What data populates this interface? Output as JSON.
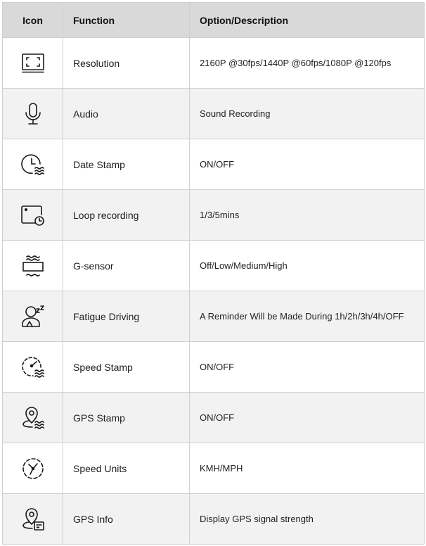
{
  "header": {
    "icon": "Icon",
    "function": "Function",
    "description": "Option/Description"
  },
  "rows": [
    {
      "icon": "resolution-frame-icon",
      "function": "Resolution",
      "description": "2160P @30fps/1440P @60fps/1080P @120fps"
    },
    {
      "icon": "microphone-icon",
      "function": "Audio",
      "description": "Sound Recording"
    },
    {
      "icon": "clock-stamp-icon",
      "function": "Date Stamp",
      "description": "ON/OFF"
    },
    {
      "icon": "loop-recording-icon",
      "function": "Loop recording",
      "description": "1/3/5mins"
    },
    {
      "icon": "g-sensor-icon",
      "function": "G-sensor",
      "description": "Off/Low/Medium/High"
    },
    {
      "icon": "fatigue-driver-icon",
      "function": "Fatigue Driving",
      "description": "A Reminder Will be Made During 1h/2h/3h/4h/OFF"
    },
    {
      "icon": "speedometer-stamp-icon",
      "function": "Speed Stamp",
      "description": "ON/OFF"
    },
    {
      "icon": "location-pin-stamp-icon",
      "function": "GPS Stamp",
      "description": "ON/OFF"
    },
    {
      "icon": "speedometer-icon",
      "function": "Speed Units",
      "description": "KMH/MPH"
    },
    {
      "icon": "location-pin-info-icon",
      "function": "GPS Info",
      "description": "Display GPS signal strength"
    }
  ]
}
